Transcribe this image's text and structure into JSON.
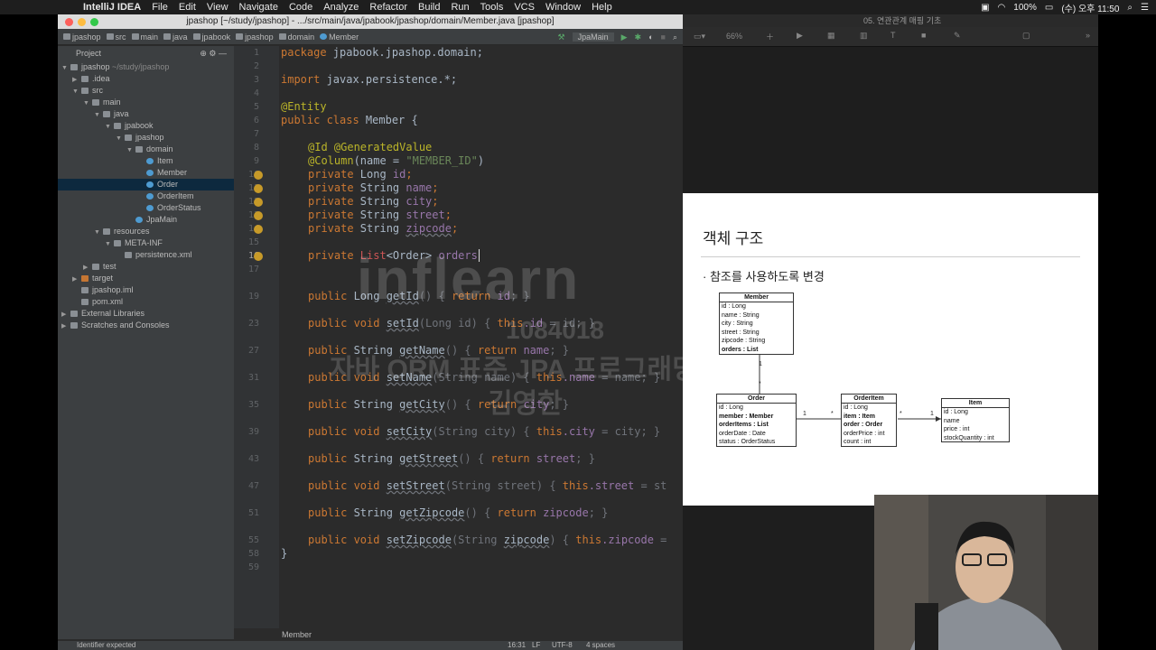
{
  "menubar": {
    "app": "IntelliJ IDEA",
    "items": [
      "File",
      "Edit",
      "View",
      "Navigate",
      "Code",
      "Analyze",
      "Refactor",
      "Build",
      "Run",
      "Tools",
      "VCS",
      "Window",
      "Help"
    ],
    "battery": "100%",
    "clock": "(수) 오후 11:50"
  },
  "ide": {
    "window_title": "jpashop [~/study/jpashop] - .../src/main/java/jpabook/jpashop/domain/Member.java [jpashop]",
    "breadcrumbs": [
      "jpashop",
      "src",
      "main",
      "java",
      "jpabook",
      "jpashop",
      "domain",
      "Member"
    ],
    "run_config": "JpaMain",
    "project_label": "Project",
    "tree": [
      {
        "label": "jpashop",
        "suffix": "~/study/jpashop",
        "depth": 0,
        "arrow": "▼",
        "icon": "folder"
      },
      {
        "label": ".idea",
        "depth": 1,
        "arrow": "▶",
        "icon": "folder"
      },
      {
        "label": "src",
        "depth": 1,
        "arrow": "▼",
        "icon": "folder"
      },
      {
        "label": "main",
        "depth": 2,
        "arrow": "▼",
        "icon": "folder"
      },
      {
        "label": "java",
        "depth": 3,
        "arrow": "▼",
        "icon": "folder"
      },
      {
        "label": "jpabook",
        "depth": 4,
        "arrow": "▼",
        "icon": "folder"
      },
      {
        "label": "jpashop",
        "depth": 5,
        "arrow": "▼",
        "icon": "folder"
      },
      {
        "label": "domain",
        "depth": 6,
        "arrow": "▼",
        "icon": "folder"
      },
      {
        "label": "Item",
        "depth": 7,
        "arrow": "",
        "icon": "class"
      },
      {
        "label": "Member",
        "depth": 7,
        "arrow": "",
        "icon": "class"
      },
      {
        "label": "Order",
        "depth": 7,
        "arrow": "",
        "icon": "class",
        "selected": true
      },
      {
        "label": "OrderItem",
        "depth": 7,
        "arrow": "",
        "icon": "class"
      },
      {
        "label": "OrderStatus",
        "depth": 7,
        "arrow": "",
        "icon": "class"
      },
      {
        "label": "JpaMain",
        "depth": 6,
        "arrow": "",
        "icon": "class"
      },
      {
        "label": "resources",
        "depth": 3,
        "arrow": "▼",
        "icon": "folder"
      },
      {
        "label": "META-INF",
        "depth": 4,
        "arrow": "▼",
        "icon": "folder"
      },
      {
        "label": "persistence.xml",
        "depth": 5,
        "arrow": "",
        "icon": "file"
      },
      {
        "label": "test",
        "depth": 2,
        "arrow": "▶",
        "icon": "folder"
      },
      {
        "label": "target",
        "depth": 1,
        "arrow": "▶",
        "icon": "target"
      },
      {
        "label": "jpashop.iml",
        "depth": 1,
        "arrow": "",
        "icon": "file"
      },
      {
        "label": "pom.xml",
        "depth": 1,
        "arrow": "",
        "icon": "file"
      },
      {
        "label": "External Libraries",
        "depth": 0,
        "arrow": "▶",
        "icon": "folder"
      },
      {
        "label": "Scratches and Consoles",
        "depth": 0,
        "arrow": "▶",
        "icon": "folder"
      }
    ],
    "line_numbers": [
      "1",
      "2",
      "3",
      "4",
      "5",
      "6",
      "7",
      "8",
      "9",
      "10",
      "11",
      "12",
      "13",
      "14",
      "15",
      "16",
      "17",
      "19",
      "23",
      "27",
      "31",
      "35",
      "39",
      "43",
      "47",
      "51",
      "55",
      "58",
      "59"
    ],
    "code_breadcrumb": "Member",
    "status": {
      "message": "Identifier expected",
      "position": "16:31",
      "line_sep": "LF",
      "encoding": "UTF-8",
      "indent": "4 spaces"
    }
  },
  "code": {
    "l1_kw": "package ",
    "l1_rest": "jpabook.jpashop.domain;",
    "l3_kw": "import ",
    "l3_rest": "javax.persistence.*;",
    "l5": "@Entity",
    "l6_kw": "public class ",
    "l6_rest": "Member {",
    "l8": "@Id @GeneratedValue",
    "l9_an": "@Column",
    "l9_a": "(name = ",
    "l9_str": "\"MEMBER_ID\"",
    "l9_b": ")",
    "f_private": "private ",
    "l10_type": "Long ",
    "l10_name": "id",
    "semi": ";",
    "l11_type": "String ",
    "l11_name": "name",
    "l12_type": "String ",
    "l12_name": "city",
    "l13_type": "String ",
    "l13_name": "street",
    "l14_type": "String ",
    "l14_name": "zipcode",
    "l16_list": "List",
    "l16_gen": "<Order> ",
    "l16_name": "orders",
    "public": "public ",
    "g1": "Long ",
    "g1_m": "getId",
    "g1_r": "() { ",
    "ret": "return ",
    "g1_v": "id",
    "g_end": "; }",
    "s1": "void ",
    "s1_m": "setId",
    "s1_r": "(Long id) { ",
    "this": "this",
    "s1_f": ".id",
    "s1_e": " = id; }",
    "g2": "String ",
    "g2_m": "getName",
    "g2_v": "name",
    "s2_m": "setName",
    "s2_r": "(String name) { ",
    "s2_f": ".name",
    "s2_e": " = name; }",
    "g3_m": "getCity",
    "g3_v": "city",
    "s3_m": "setCity",
    "s3_r": "(String city) { ",
    "s3_f": ".city",
    "s3_e": " = city; }",
    "g4_m": "getStreet",
    "g4_v": "street",
    "s4_m": "setStreet",
    "s4_r": "(String street) { ",
    "s4_f": ".street",
    "s4_e": " = st",
    "g5_m": "getZipcode",
    "g5_v": "zipcode",
    "s5_m": "setZipcode",
    "s5_r": "(String ",
    "s5_p": "zipcode",
    "s5_r2": ") { ",
    "s5_f": ".zipcode",
    "s5_e": " =",
    "close": "}"
  },
  "watermark": {
    "brand": "inflearn",
    "id": "1084018",
    "course": "자바 ORM 표준 JPA 프로그래밍 - 기본편",
    "name": "김영한"
  },
  "keynote": {
    "window_title": "05. 연관관계 매핑 기초",
    "zoom": "66%"
  },
  "slide": {
    "title": "객체 구조",
    "bullet": "참조를 사용하도록 변경",
    "member": {
      "name": "Member",
      "fields": [
        "id : Long",
        "name : String",
        "city : String",
        "street : String",
        "zipcode : String",
        "orders : List"
      ]
    },
    "order": {
      "name": "Order",
      "fields": [
        "id : Long",
        "member : Member",
        "orderItems : List",
        "orderDate : Date",
        "status : OrderStatus"
      ]
    },
    "orderitem": {
      "name": "OrderItem",
      "fields": [
        "id : Long",
        "item : Item",
        "order : Order",
        "orderPrice : int",
        "count : int"
      ]
    },
    "item": {
      "name": "Item",
      "fields": [
        "id : Long",
        "name",
        "price : int",
        "stockQuantity : int"
      ]
    },
    "mult_one": "1",
    "mult_many": "*"
  }
}
